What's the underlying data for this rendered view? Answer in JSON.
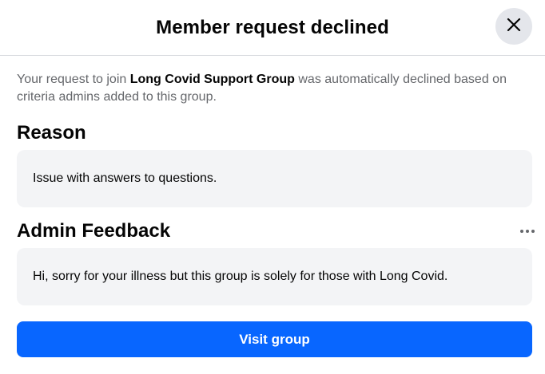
{
  "dialog": {
    "title": "Member request declined",
    "close_icon": "close-icon"
  },
  "intro": {
    "prefix": "Your request to join ",
    "group_name": "Long Covid Support Group",
    "suffix": " was automatically declined based on criteria admins added to this group."
  },
  "reason": {
    "heading": "Reason",
    "text": "Issue with answers to questions."
  },
  "feedback": {
    "heading": "Admin Feedback",
    "more_icon": "more-horizontal-icon",
    "text": "Hi, sorry for your illness but this group is solely for those with Long Covid."
  },
  "actions": {
    "visit_label": "Visit group"
  },
  "colors": {
    "primary": "#0866ff",
    "card_bg": "#f3f4f6",
    "secondary_text": "#65676b",
    "close_bg": "#e4e6eb"
  }
}
